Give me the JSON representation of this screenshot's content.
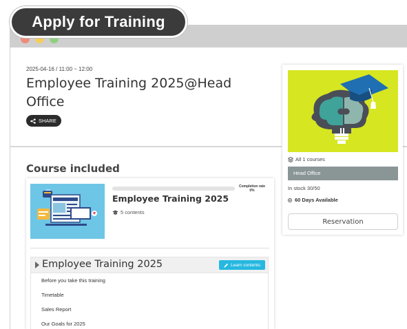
{
  "header": {
    "title": "Apply for Training"
  },
  "event": {
    "datetime": "2025-04-16 / 11:00 ~ 12:00",
    "title": "Employee Training 2025@Head Office",
    "share_label": "SHARE"
  },
  "courses_section": {
    "heading": "Course included",
    "course": {
      "name": "Employee Training 2025",
      "contents_count": "5 contents",
      "completion_label": "Completion rate",
      "completion_value": "0%",
      "completion_fraction": 0
    },
    "section": {
      "title": "Employee Training 2025",
      "learn_button": "Learn contents",
      "lessons": [
        "Before you take this training",
        "Timetable",
        "Sales Report",
        "Our Goals for 2025"
      ]
    }
  },
  "sidebar": {
    "all_courses": "All 1 courses",
    "location": "Head Office",
    "stock": "In stock 30/50",
    "availability": "60 Days Available",
    "reserve_button": "Reservation"
  },
  "colors": {
    "accent": "#26b8e0",
    "title_pill": "#3b3b3b",
    "location_bar": "#8a9596",
    "image_bg": "#d6e621",
    "thumb_bg": "#6ec6e6"
  },
  "icons": {
    "share": "share-icon",
    "contents": "graduation-cap-icon",
    "courses": "stack-icon",
    "learn": "pencil-icon",
    "availability": "radio-dot-icon"
  }
}
